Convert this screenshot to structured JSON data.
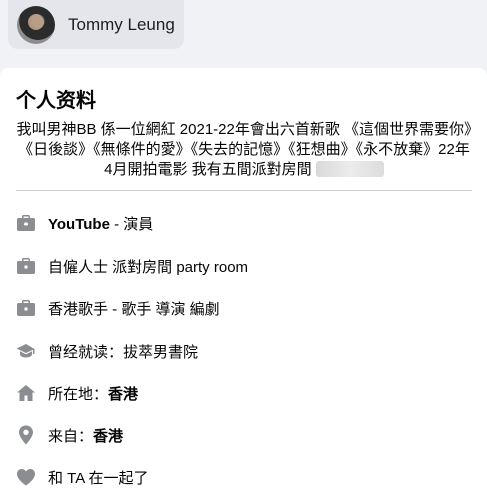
{
  "profile": {
    "name": "Tommy Leung"
  },
  "intro": {
    "title": "个人资料",
    "bio": "我叫男神BB 係一位網紅 2021-22年會出六首新歌 《這個世界需要你》《日後談》《無條件的愛》《失去的記憶》《狂想曲》《永不放棄》22年4月開拍電影 我有五間派對房間"
  },
  "details": [
    {
      "icon": "briefcase-icon",
      "strong": "YouTube",
      "rest": " - 演員"
    },
    {
      "icon": "briefcase-icon",
      "text": "自僱人士 派對房間 party room"
    },
    {
      "icon": "briefcase-icon",
      "text": "香港歌手 - 歌手 導演 編劇"
    },
    {
      "icon": "graduation-cap-icon",
      "text": "曾经就读：拔萃男書院"
    },
    {
      "icon": "home-icon",
      "label": "所在地：",
      "value": "香港"
    },
    {
      "icon": "location-pin-icon",
      "label": "来自：",
      "value": "香港"
    },
    {
      "icon": "heart-icon",
      "text": "和 TA 在一起了"
    }
  ],
  "colors": {
    "icon": "#8a8d91",
    "card": "#ffffff",
    "background": "#f0f2f5"
  }
}
